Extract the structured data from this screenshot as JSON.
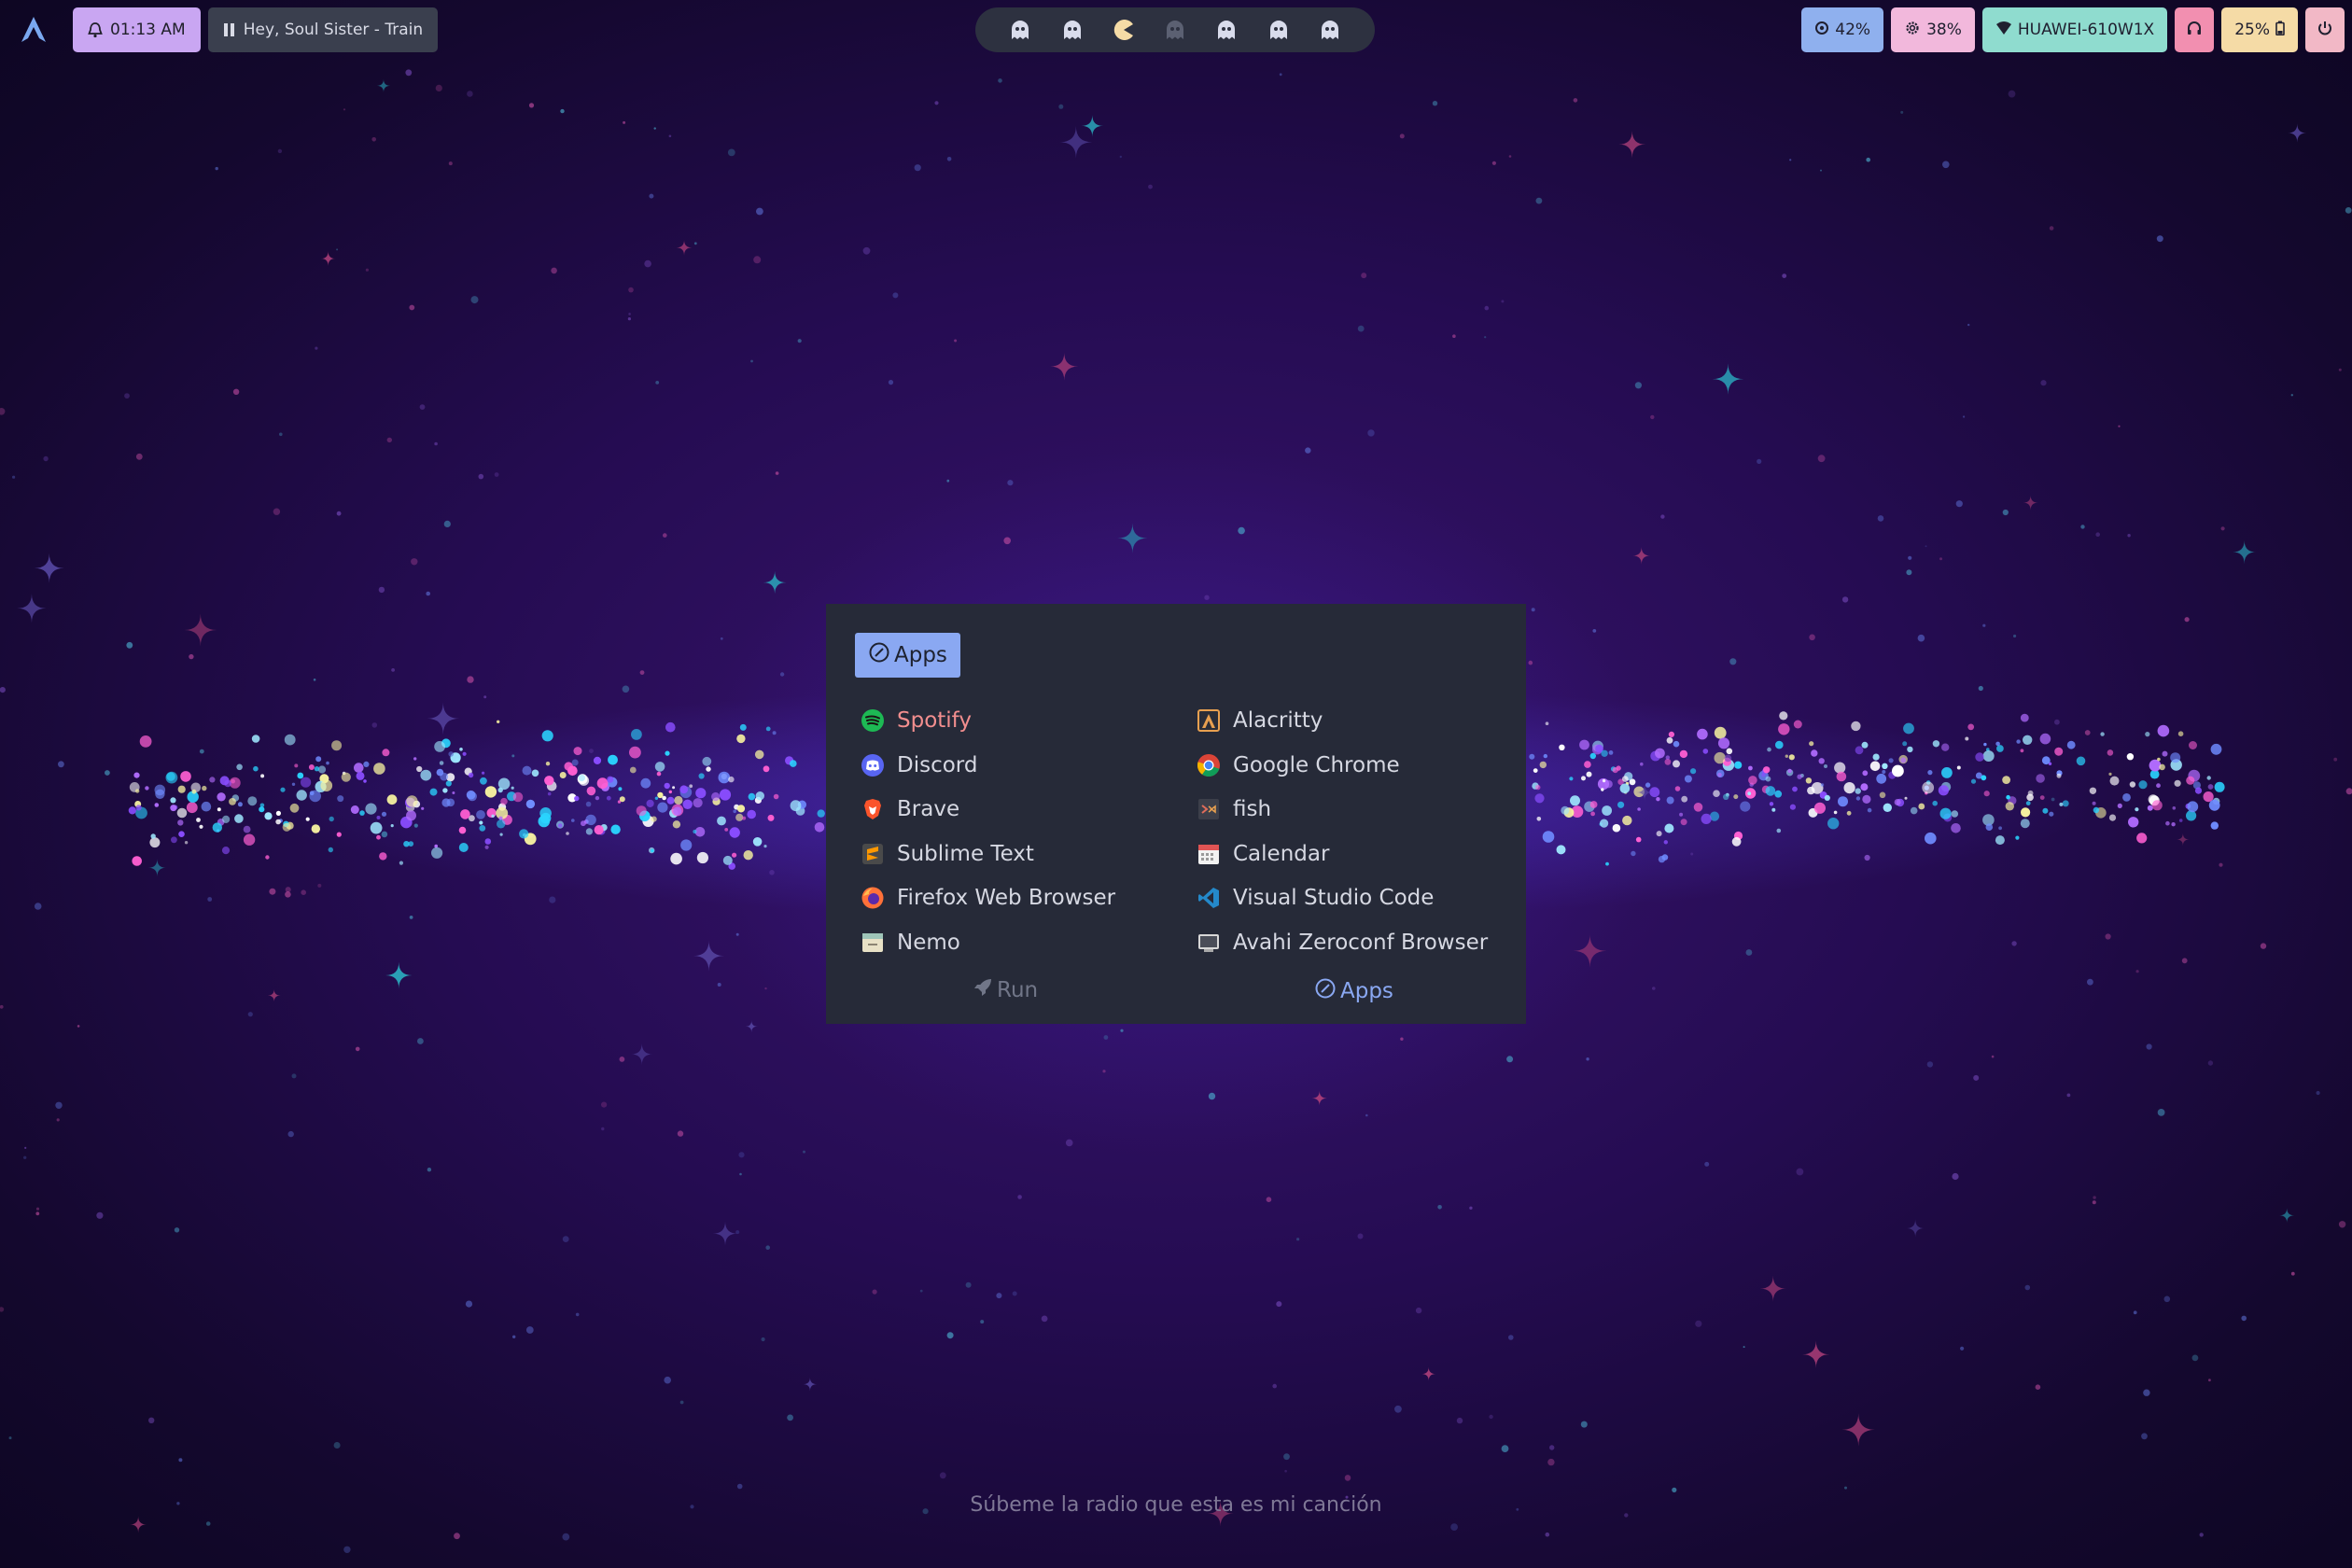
{
  "topbar": {
    "time": "01:13 AM",
    "media_title": "Hey, Soul Sister - Train",
    "workspaces": [
      "ghost",
      "ghost",
      "pacman",
      "ghost-dim",
      "ghost",
      "ghost",
      "ghost"
    ],
    "volume": "42%",
    "cpu": "38%",
    "wifi": "HUAWEI-610W1X",
    "battery": "25%"
  },
  "launcher": {
    "tab_label": "Apps",
    "apps_left": [
      {
        "label": "Spotify",
        "icon": "spotify-icon",
        "active": true
      },
      {
        "label": "Discord",
        "icon": "discord-icon"
      },
      {
        "label": "Brave",
        "icon": "brave-icon"
      },
      {
        "label": "Sublime Text",
        "icon": "sublime-icon"
      },
      {
        "label": "Firefox Web Browser",
        "icon": "firefox-icon"
      },
      {
        "label": "Nemo",
        "icon": "nemo-icon"
      }
    ],
    "apps_right": [
      {
        "label": "Alacritty",
        "icon": "alacritty-icon"
      },
      {
        "label": "Google Chrome",
        "icon": "chrome-icon"
      },
      {
        "label": "fish",
        "icon": "fish-icon"
      },
      {
        "label": "Calendar",
        "icon": "calendar-icon"
      },
      {
        "label": "Visual Studio Code",
        "icon": "vscode-icon"
      },
      {
        "label": "Avahi Zeroconf Browser",
        "icon": "avahi-icon"
      }
    ],
    "footer": {
      "run_label": "Run",
      "apps_label": "Apps"
    }
  },
  "lyric": "Súbeme la radio que esta es mi canción",
  "colors": {
    "accent_blue": "#8aa8f2",
    "active_app": "#f28e8e",
    "launcher_bg": "#262a38"
  }
}
